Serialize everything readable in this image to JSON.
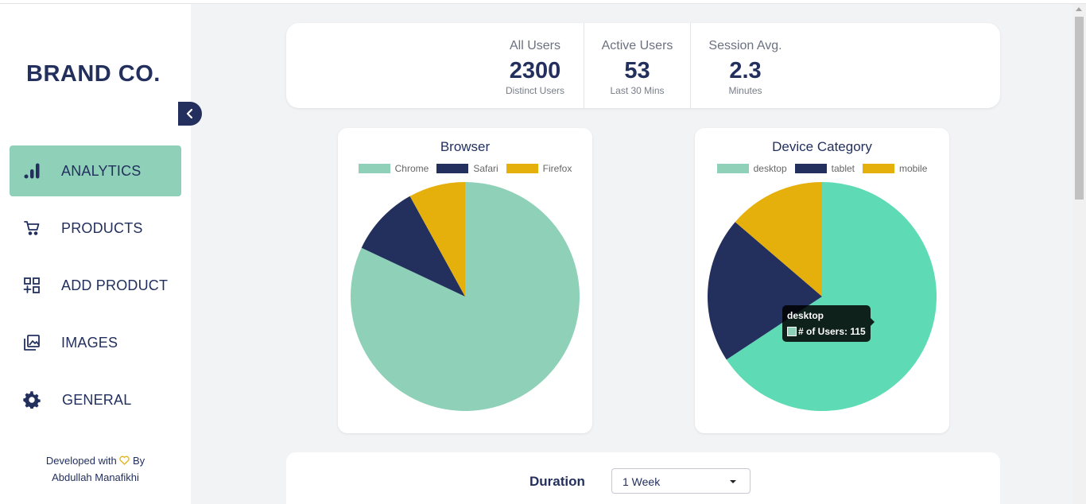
{
  "sidebar": {
    "brand": "BRAND CO.",
    "items": [
      {
        "label": "ANALYTICS",
        "icon": "bar-chart-icon",
        "active": true
      },
      {
        "label": "PRODUCTS",
        "icon": "cart-icon",
        "active": false
      },
      {
        "label": "ADD PRODUCT",
        "icon": "add-grid-icon",
        "active": false
      },
      {
        "label": "IMAGES",
        "icon": "images-icon",
        "active": false
      },
      {
        "label": "GENERAL",
        "icon": "gear-icon",
        "active": false
      }
    ],
    "footer_prefix": "Developed with",
    "footer_by": "By",
    "footer_author": "Abdullah Manafikhi"
  },
  "stats": [
    {
      "label": "All Users",
      "value": "2300",
      "sub": "Distinct Users"
    },
    {
      "label": "Active Users",
      "value": "53",
      "sub": "Last 30 Mins"
    },
    {
      "label": "Session Avg.",
      "value": "2.3",
      "sub": "Minutes"
    }
  ],
  "chart_data": [
    {
      "type": "pie",
      "title": "Browser",
      "labels": [
        "Chrome",
        "Safari",
        "Firefox"
      ],
      "values": [
        82,
        10,
        8
      ],
      "colors": [
        "#8fd0b8",
        "#23305e",
        "#e6b00c"
      ],
      "legend": "top"
    },
    {
      "type": "pie",
      "title": "Device Category",
      "labels": [
        "desktop",
        "tablet",
        "mobile"
      ],
      "values": [
        115,
        36,
        24
      ],
      "colors": [
        "#5edbb4",
        "#23305e",
        "#e6b00c"
      ],
      "legend": "top",
      "tooltip": {
        "title": "desktop",
        "series": "# of Users",
        "value": 115
      }
    }
  ],
  "tooltip_text": "# of Users: 115",
  "duration": {
    "label": "Duration",
    "selected": "1 Week"
  },
  "colors": {
    "accent": "#8fd0b8",
    "navy": "#23305e",
    "gold": "#e6b00c",
    "background": "#f2f3f5"
  }
}
